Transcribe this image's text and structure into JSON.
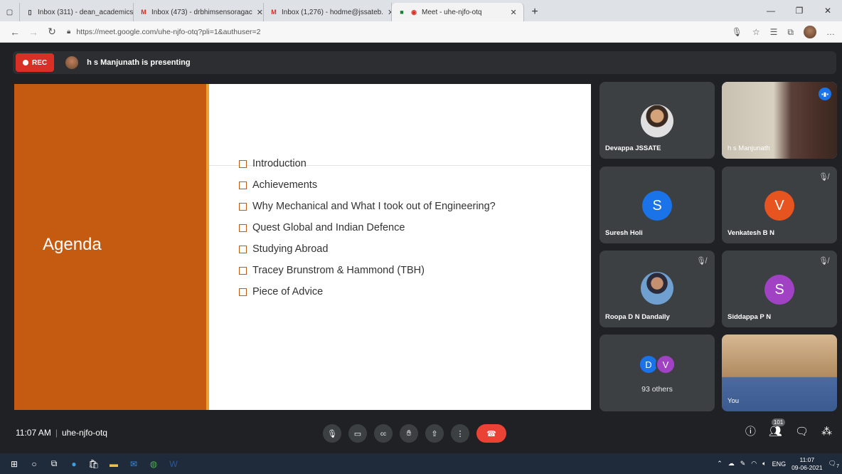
{
  "browser": {
    "tabs": [
      {
        "title": "Inbox (311) - dean_academics@",
        "icon": "page-icon"
      },
      {
        "title": "Inbox (473) - drbhimsensoragac",
        "icon": "gmail-icon"
      },
      {
        "title": "Inbox (1,276) - hodme@jssateb.",
        "icon": "gmail-icon"
      },
      {
        "title": "Meet - uhe-njfo-otq",
        "icon": "meet-icon"
      }
    ],
    "url": "https://meet.google.com/uhe-njfo-otq?pli=1&authuser=2"
  },
  "meet": {
    "rec_label": "REC",
    "presenting_text": "h s Manjunath is presenting",
    "slide": {
      "title": "Agenda",
      "items": [
        "Introduction",
        "Achievements",
        "Why Mechanical and What I took out of Engineering?",
        "Quest Global and Indian Defence",
        "Studying Abroad",
        "Tracey Brunstrom & Hammond (TBH)",
        "Piece of Advice"
      ]
    },
    "participants": {
      "devappa": {
        "name": "Devappa JSSATE"
      },
      "manjunath": {
        "name": "h s Manjunath"
      },
      "suresh": {
        "name": "Suresh Holi",
        "initial": "S",
        "color": "#1a73e8"
      },
      "venkatesh": {
        "name": "Venkatesh B N",
        "initial": "V",
        "color": "#e8541f"
      },
      "roopa": {
        "name": "Roopa D N Dandally"
      },
      "siddappa": {
        "name": "Siddappa P N",
        "initial": "S",
        "color": "#a142c5"
      },
      "others": {
        "label": "93 others",
        "initials": [
          "D",
          "V"
        ],
        "colors": [
          "#1a73e8",
          "#a142c5"
        ]
      },
      "you": {
        "name": "You"
      }
    },
    "bottom": {
      "time": "11:07 AM",
      "meeting_code": "uhe-njfo-otq",
      "people_count": "101"
    }
  },
  "taskbar": {
    "lang": "ENG",
    "clock_time": "11:07",
    "clock_date": "09-06-2021",
    "notification_count": "7"
  }
}
